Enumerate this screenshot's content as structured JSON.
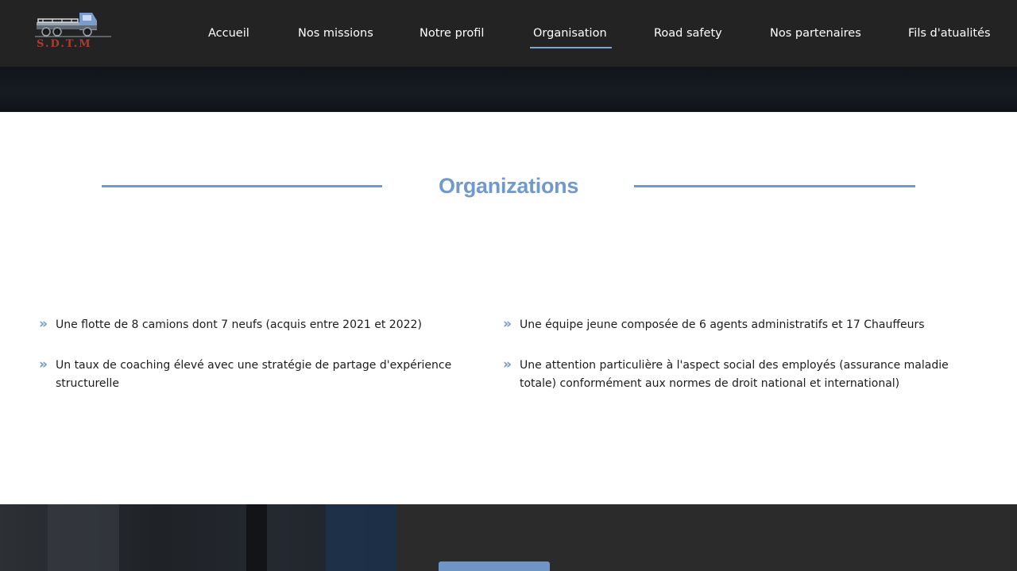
{
  "brand": {
    "logo_text": "S.D.T.M"
  },
  "nav": {
    "items": [
      {
        "label": "Accueil"
      },
      {
        "label": "Nos missions"
      },
      {
        "label": "Notre profil"
      },
      {
        "label": "Organisation",
        "active": true
      },
      {
        "label": "Road safety"
      },
      {
        "label": "Nos partenaires"
      },
      {
        "label": "Fils d'atualités"
      }
    ]
  },
  "organization": {
    "title": "Organizations",
    "features": [
      {
        "text": "Une flotte de 8 camions dont 7 neufs (acquis entre 2021 et 2022)"
      },
      {
        "text": "Une équipe jeune composée de 6 agents administratifs et 17 Chauffeurs"
      },
      {
        "text": "Un taux de coaching élevé avec une stratégie de partage d'expérience structurelle"
      },
      {
        "text": "Une attention particulière à l'aspect social des employés (assurance maladie totale) conformément aux normes de droit national et international)"
      }
    ]
  },
  "colors": {
    "accent": "#7199cc",
    "header_bg": "#232323",
    "logo_red": "#b03a2e"
  },
  "icons": {
    "logo": "truck-icon",
    "bullet": "double-chevron-right-icon"
  }
}
